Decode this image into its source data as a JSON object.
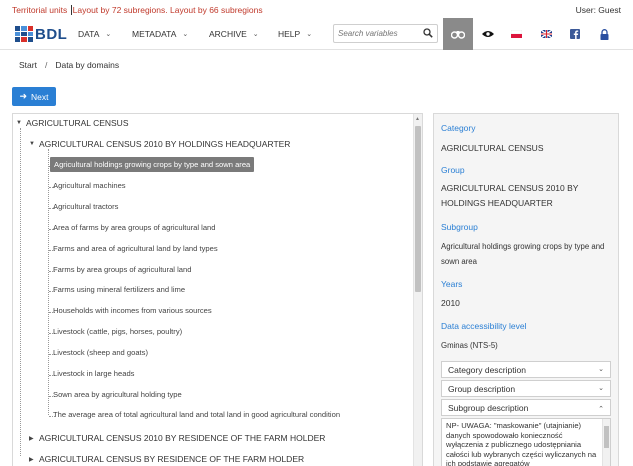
{
  "top_bar": {
    "warning_first": "Territorial units ",
    "warning_rest": "Layout by 72 subregions. Layout by 66 subregions",
    "user": "User: Guest"
  },
  "logo": {
    "text": "BDL"
  },
  "nav": {
    "menus": [
      {
        "label": "DATA"
      },
      {
        "label": "METADATA"
      },
      {
        "label": "ARCHIVE"
      },
      {
        "label": "HELP"
      }
    ],
    "search_placeholder": "Search variables",
    "icons": [
      "binoculars-icon",
      "eye-icon",
      "polish-flag-icon",
      "english-flag-icon",
      "facebook-icon",
      "lock-icon"
    ]
  },
  "breadcrumb": {
    "home": "Start",
    "sep": "/",
    "current": "Data by domains"
  },
  "next_label": "Next",
  "tree": {
    "root": "AGRICULTURAL CENSUS",
    "group_open": "AGRICULTURAL CENSUS 2010 BY HOLDINGS HEADQUARTER",
    "items": [
      "Agricultural holdings growing crops by type and sown area",
      "Agricultural machines",
      "Agricultural tractors",
      "Area of farms by area groups of agricultural land",
      "Farms and area of agricultural land by land types",
      "Farms by area groups of agricultural land",
      "Farms using mineral fertilizers and lime",
      "Households with incomes from various sources",
      "Livestock (cattle, pigs, horses, poultry)",
      "Livestock (sheep and goats)",
      "Livestock in large heads",
      "Sown area by agricultural holding type",
      "The average area of total agricultural land and total land in good agricultural condition"
    ],
    "groups_closed": [
      "AGRICULTURAL CENSUS 2010 BY RESIDENCE OF THE FARM HOLDER",
      "AGRICULTURAL CENSUS BY RESIDENCE OF THE FARM HOLDER"
    ]
  },
  "info": {
    "category_label": "Category",
    "category_value": "AGRICULTURAL CENSUS",
    "group_label": "Group",
    "group_value": "AGRICULTURAL CENSUS 2010 BY HOLDINGS HEADQUARTER",
    "subgroup_label": "Subgroup",
    "subgroup_value": "Agricultural holdings growing crops by type and sown area",
    "years_label": "Years",
    "years_value": "2010",
    "access_label": "Data accessibility level",
    "access_value": "Gminas (NTS-5)",
    "category_desc": "Category description",
    "group_desc": "Group description",
    "subgroup_desc": "Subgroup description",
    "desc_text": "NP- UWAGA: \"maskowanie\" (utajnianie) danych spowodowało konieczność wyłączenia z publicznego udostępniania całości lub wybranych części wyliczanych na ich podstawie agregatów"
  }
}
